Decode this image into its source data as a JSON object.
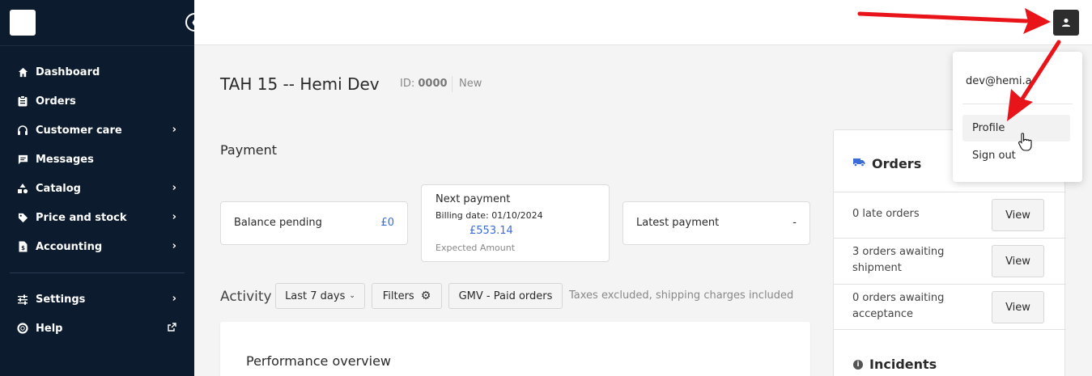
{
  "sidebar": {
    "nav": [
      {
        "label": "Dashboard",
        "icon": "home-icon",
        "chevron": false
      },
      {
        "label": "Orders",
        "icon": "clipboard-icon",
        "chevron": false
      },
      {
        "label": "Customer care",
        "icon": "headset-icon",
        "chevron": true
      },
      {
        "label": "Messages",
        "icon": "message-icon",
        "chevron": false
      },
      {
        "label": "Catalog",
        "icon": "shapes-icon",
        "chevron": true
      },
      {
        "label": "Price and stock",
        "icon": "tag-icon",
        "chevron": true
      },
      {
        "label": "Accounting",
        "icon": "invoice-icon",
        "chevron": true
      }
    ],
    "nav_bottom": [
      {
        "label": "Settings",
        "icon": "sliders-icon",
        "chevron": true
      },
      {
        "label": "Help",
        "icon": "lifebuoy-icon",
        "external": true
      }
    ]
  },
  "page": {
    "title": "TAH 15 -- Hemi Dev",
    "id_label": "ID:",
    "id_value": "0000",
    "status": "New"
  },
  "payment": {
    "title": "Payment",
    "balance_label": "Balance pending",
    "balance_value": "£0",
    "next_label": "Next payment",
    "billing_date": "Billing date: 01/10/2024",
    "next_amount": "£553.14",
    "expected_label": "Expected Amount",
    "latest_label": "Latest payment",
    "latest_value": "-"
  },
  "activity": {
    "title": "Activity",
    "period": "Last 7 days",
    "filters": "Filters",
    "metric": "GMV - Paid orders",
    "note": "Taxes excluded, shipping charges included",
    "performance_title": "Performance overview"
  },
  "orders_panel": {
    "title": "Orders",
    "rows": [
      {
        "text": "0 late orders",
        "button": "View"
      },
      {
        "text": "3 orders awaiting shipment",
        "button": "View"
      },
      {
        "text": "0 orders awaiting acceptance",
        "button": "View"
      }
    ],
    "incidents_title": "Incidents"
  },
  "user_menu": {
    "email": "dev@hemi.a",
    "profile": "Profile",
    "sign_out": "Sign out"
  },
  "colors": {
    "sidebar_bg": "#0d1b2e",
    "accent_blue": "#3b6cd6",
    "annotation_red": "#e8141a"
  }
}
